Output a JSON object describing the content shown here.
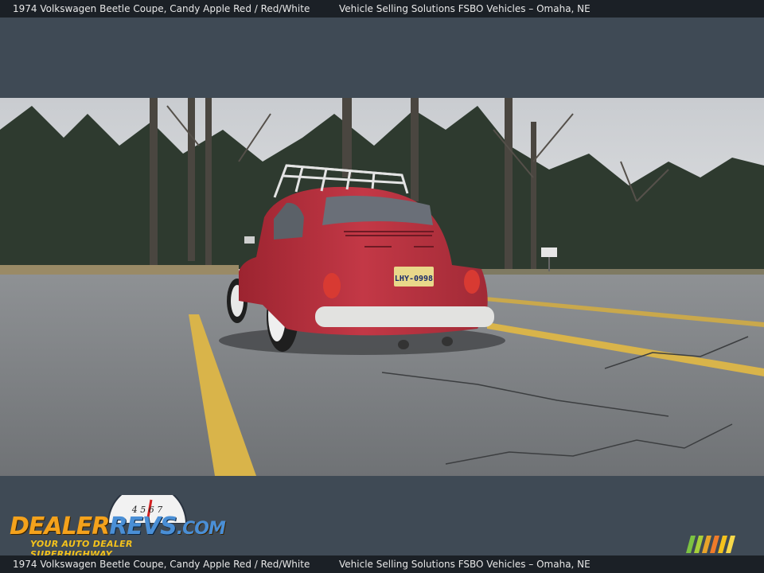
{
  "header": {
    "title": "1974 Volkswagen Beetle Coupe,   Candy Apple Red / Red/White",
    "dealer": "Vehicle Selling Solutions FSBO Vehicles – Omaha, NE"
  },
  "footer": {
    "title": "1974 Volkswagen Beetle Coupe,   Candy Apple Red / Red/White",
    "dealer": "Vehicle Selling Solutions FSBO Vehicles – Omaha, NE"
  },
  "photo": {
    "plate": "LHY-0998"
  },
  "logo": {
    "dealer": "DEALER",
    "revs": "REVS",
    "com": ".COM",
    "tagline": "YOUR AUTO DEALER SUPERHIGHWAY",
    "gauge_digits": "4 5 6 7"
  },
  "colors": {
    "background": "#3f4a55",
    "bar": "#1b2026",
    "logo_orange": "#f4a21c",
    "logo_blue": "#4a8fd6",
    "car_red": "#b7303c"
  }
}
